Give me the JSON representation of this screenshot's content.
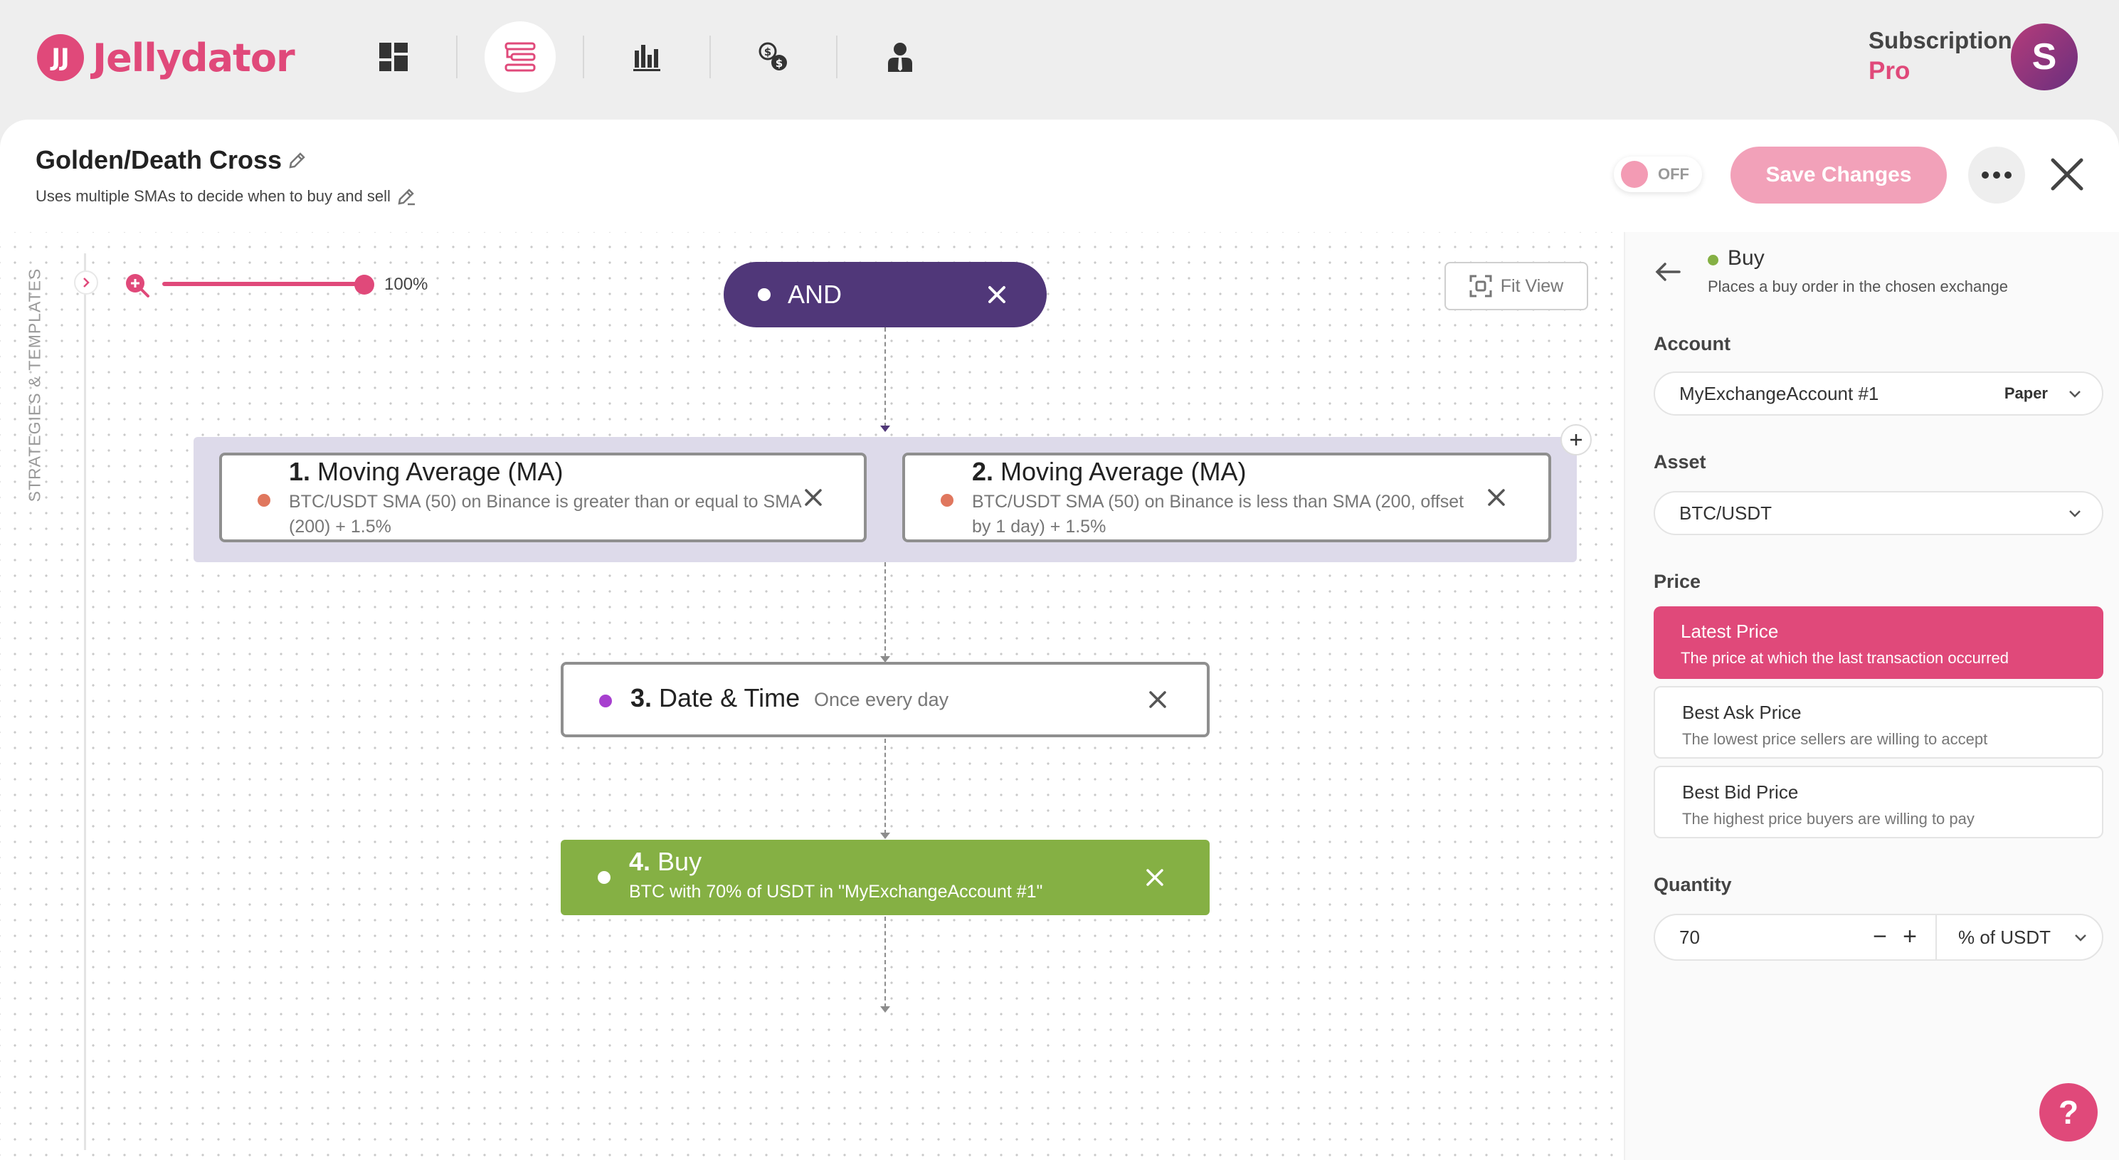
{
  "app": {
    "logo_mark": "JJ",
    "name": "Jellydator"
  },
  "nav": {
    "items": [
      {
        "icon": "dashboard-icon",
        "active": false
      },
      {
        "icon": "strategies-icon",
        "active": true
      },
      {
        "icon": "bar-chart-icon",
        "active": false
      },
      {
        "icon": "currency-exchange-icon",
        "active": false
      },
      {
        "icon": "user-icon",
        "active": false
      }
    ]
  },
  "subscription": {
    "label": "Subscription",
    "plan": "Pro",
    "avatar_letter": "S"
  },
  "strategy": {
    "title": "Golden/Death Cross",
    "description": "Uses multiple SMAs to decide when to buy and sell"
  },
  "toolbar": {
    "toggle_label": "OFF",
    "save_label": "Save Changes"
  },
  "canvas": {
    "side_label": "STRATEGIES & TEMPLATES",
    "zoom_value": "100%",
    "zoom_fraction": 1.0,
    "fit_view_label": "Fit View"
  },
  "nodes": {
    "and_label": "AND",
    "ma1": {
      "num": "1.",
      "title": "Moving Average (MA)",
      "text": "BTC/USDT SMA (50) on Binance is greater than or equal to SMA (200) + 1.5%",
      "dot_color": "#e0775e"
    },
    "ma2": {
      "num": "2.",
      "title": "Moving Average (MA)",
      "text": "BTC/USDT SMA (50) on Binance is less than SMA (200, offset by 1 day) + 1.5%",
      "dot_color": "#e0775e"
    },
    "datetime": {
      "num": "3.",
      "title": "Date & Time",
      "text": "Once every day",
      "dot_color": "#a73fcf"
    },
    "buy": {
      "num": "4.",
      "title": "Buy",
      "text": "BTC with 70% of USDT in \"MyExchangeAccount #1\"",
      "color": "#85b044"
    }
  },
  "panel": {
    "title": "Buy",
    "subtitle": "Places a buy order in the chosen exchange",
    "account_label": "Account",
    "account_value": "MyExchangeAccount #1",
    "account_tag": "Paper",
    "asset_label": "Asset",
    "asset_value": "BTC/USDT",
    "price_label": "Price",
    "price_options": [
      {
        "title": "Latest Price",
        "sub": "The price at which the last transaction occurred",
        "selected": true
      },
      {
        "title": "Best Ask Price",
        "sub": "The lowest price sellers are willing to accept",
        "selected": false
      },
      {
        "title": "Best Bid Price",
        "sub": "The highest price buyers are willing to pay",
        "selected": false
      }
    ],
    "quantity_label": "Quantity",
    "quantity_value": "70",
    "quantity_minus": "−",
    "quantity_plus": "+",
    "quantity_unit": "% of USDT"
  },
  "help_label": "?",
  "colors": {
    "brand": "#e0497a",
    "and_node": "#503779",
    "group_bg": "#dddaea",
    "buy_node": "#85b044"
  }
}
